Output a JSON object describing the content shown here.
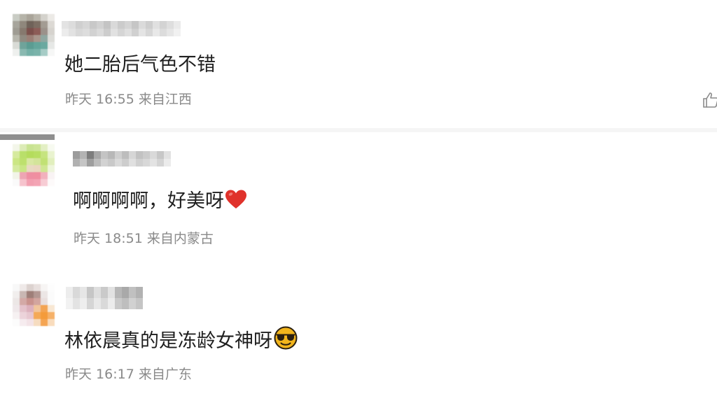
{
  "comments": [
    {
      "text": "她二胎后气色不错",
      "time": "昨天 16:55",
      "location": "来自江西"
    },
    {
      "text": "啊啊啊啊，好美呀",
      "time": "昨天 18:51",
      "location": "来自内蒙古"
    },
    {
      "text": "林依晨真的是冻龄女神呀",
      "time": "昨天 16:17",
      "location": "来自广东"
    }
  ],
  "icons": {
    "heart": "heart-emoji",
    "sunglasses": "sunglasses-emoji",
    "like": "thumbs-up-icon"
  },
  "colors": {
    "meta_text": "#8a8a8a",
    "comment_text": "#1f1f1f",
    "heart": "#e0322b",
    "emoji_face": "#f2b51c"
  }
}
